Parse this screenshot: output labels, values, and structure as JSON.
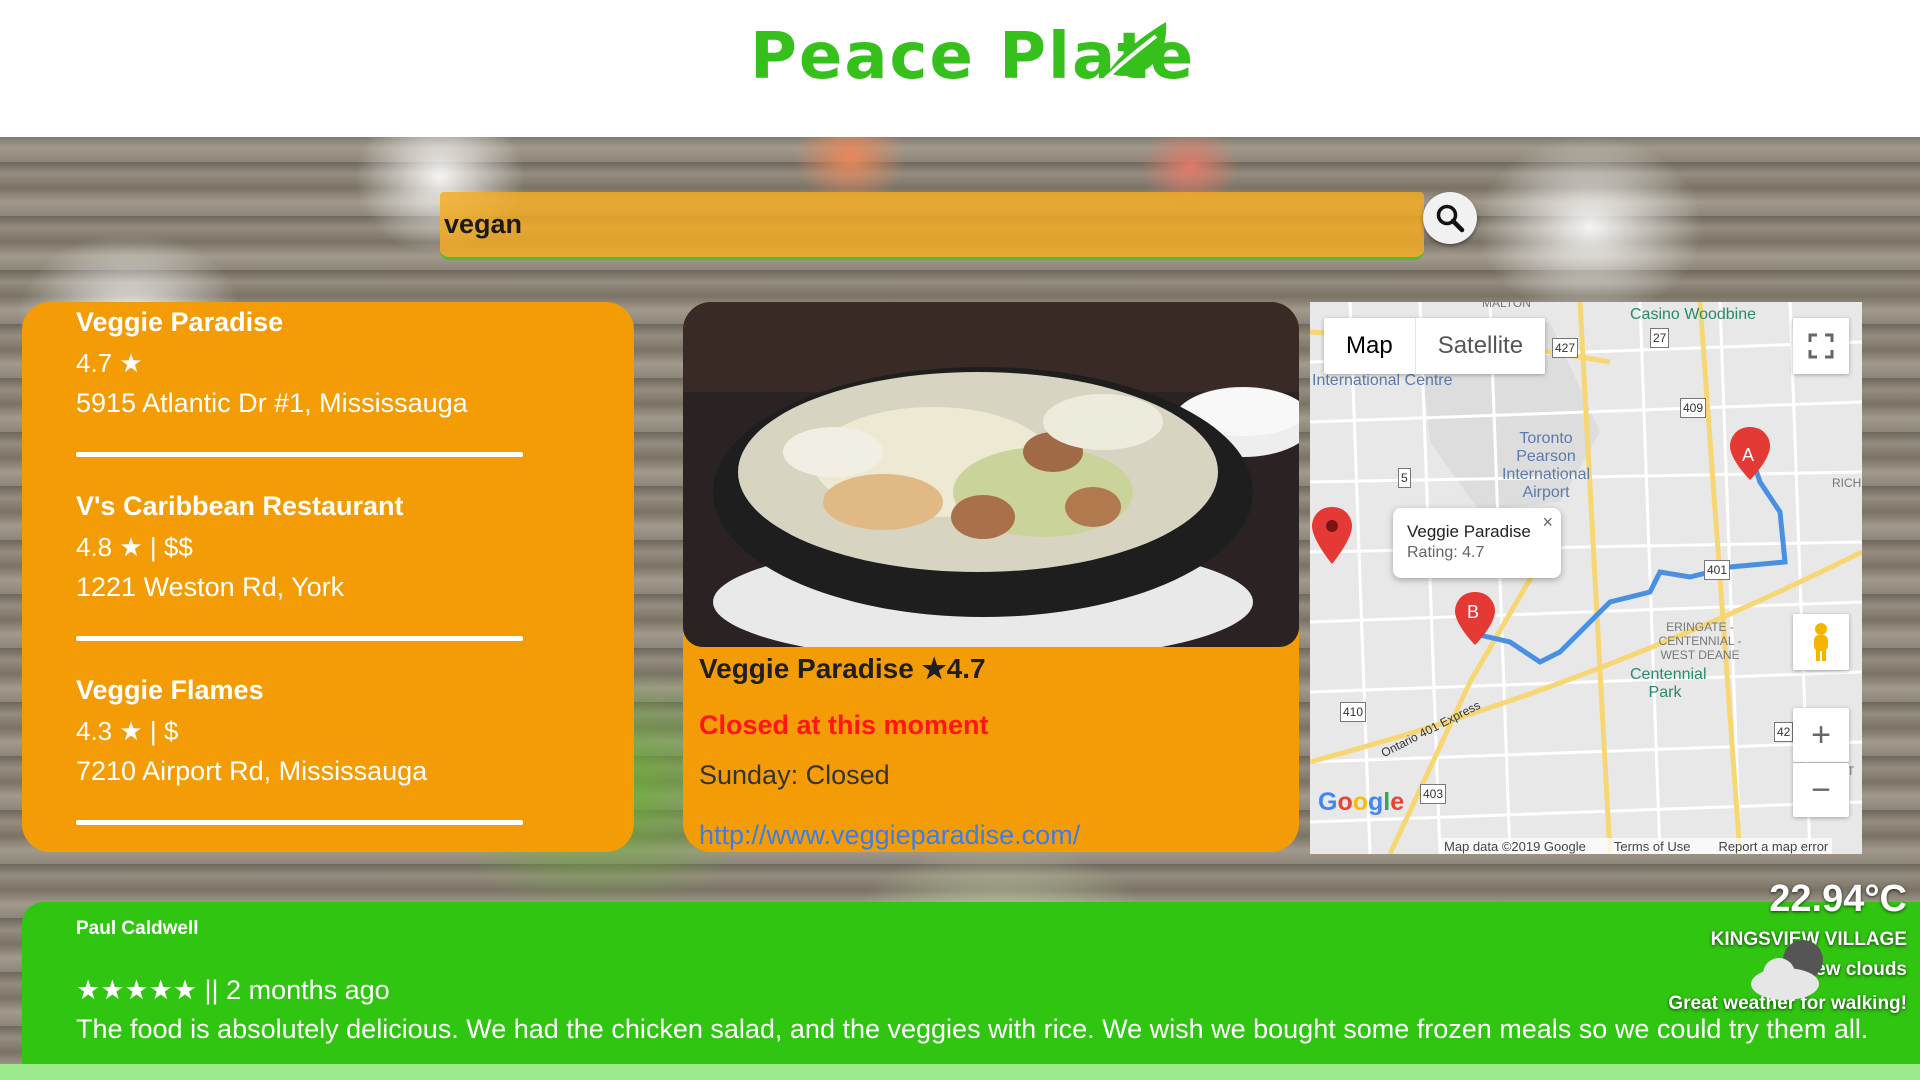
{
  "header": {
    "logo_text": "Peace Plate"
  },
  "search": {
    "query": "vegan"
  },
  "results": [
    {
      "name": "Veggie Paradise",
      "rating": "4.7 ★",
      "address": "5915 Atlantic Dr #1, Mississauga"
    },
    {
      "name": "V's Caribbean Restaurant",
      "rating": "4.8 ★ | $$",
      "address": "1221 Weston Rd, York"
    },
    {
      "name": "Veggie Flames",
      "rating": "4.3 ★ | $",
      "address": "7210 Airport Rd, Mississauga"
    }
  ],
  "detail": {
    "title": "Veggie Paradise ★4.7",
    "status": "Closed at this moment",
    "hours": "Sunday: Closed",
    "url": "http://www.veggieparadise.com/"
  },
  "map": {
    "tab_map": "Map",
    "tab_satellite": "Satellite",
    "info_title": "Veggie Paradise",
    "info_rating": "Rating: 4.7",
    "marker_a": "A",
    "marker_b": "B",
    "labels": {
      "casino": "Casino Woodbine",
      "intl_centre": "International Centre",
      "airport": "Toronto Pearson International Airport",
      "eringate": "ERINGATE - CENTENNIAL - WEST DEANE",
      "centennial": "Centennial Park",
      "highway": "Ontario 401 Express",
      "rich": "RICH",
      "eat": "EAT",
      "malton": "MALTON"
    },
    "shields": [
      "427",
      "27",
      "409",
      "5",
      "401",
      "410",
      "403",
      "42"
    ],
    "google": "Google",
    "map_data": "Map data ©2019 Google",
    "terms": "Terms of Use",
    "report": "Report a map error"
  },
  "review": {
    "author": "Paul Caldwell",
    "meta": "★★★★★ || 2 months ago",
    "text": "The food is absolutely delicious. We had the chicken salad, and the veggies with rice. We wish we bought some frozen meals so we could try them all."
  },
  "weather": {
    "temperature": "22.94°C",
    "location": "KINGSVIEW VILLAGE",
    "description": "few clouds",
    "message": "Great weather for walking!"
  },
  "colors": {
    "brand_green": "#36c01c",
    "panel_orange": "#f39c06",
    "review_green": "#30c511",
    "closed_red": "#ff1616",
    "link_blue": "#3d7de6"
  }
}
